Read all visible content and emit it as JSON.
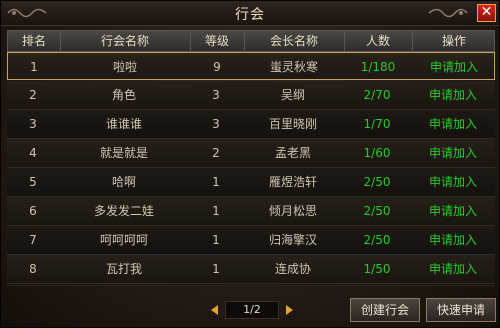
{
  "window": {
    "title": "行会"
  },
  "columns": [
    "排名",
    "行会名称",
    "等级",
    "会长名称",
    "人数",
    "操作"
  ],
  "rows": [
    {
      "rank": "1",
      "name": "啦啦",
      "level": "9",
      "leader": "蚩灵秋寒",
      "members": "1/180",
      "action": "申请加入"
    },
    {
      "rank": "2",
      "name": "角色",
      "level": "3",
      "leader": "吴纲",
      "members": "2/70",
      "action": "申请加入"
    },
    {
      "rank": "3",
      "name": "谁谁谁",
      "level": "3",
      "leader": "百里晓刚",
      "members": "1/70",
      "action": "申请加入"
    },
    {
      "rank": "4",
      "name": "就是就是",
      "level": "2",
      "leader": "孟老黑",
      "members": "1/60",
      "action": "申请加入"
    },
    {
      "rank": "5",
      "name": "哈啊",
      "level": "1",
      "leader": "雁煜浩轩",
      "members": "2/50",
      "action": "申请加入"
    },
    {
      "rank": "6",
      "name": "多发发二娃",
      "level": "1",
      "leader": "倾月松思",
      "members": "2/50",
      "action": "申请加入"
    },
    {
      "rank": "7",
      "name": "呵呵呵呵",
      "level": "1",
      "leader": "归海擎汉",
      "members": "2/50",
      "action": "申请加入"
    },
    {
      "rank": "8",
      "name": "瓦打我",
      "level": "1",
      "leader": "连成协",
      "members": "1/50",
      "action": "申请加入"
    }
  ],
  "pager": {
    "current": "1/2"
  },
  "buttons": {
    "create": "创建行会",
    "quick": "快速申请"
  },
  "colors": {
    "accent_green": "#27cc2a",
    "selected_border": "#c9a35a",
    "arrow": "#e0a52a",
    "close": "#d8261e"
  },
  "icons": {
    "close": "close-icon",
    "prev": "arrow-left-icon",
    "next": "arrow-right-icon"
  }
}
